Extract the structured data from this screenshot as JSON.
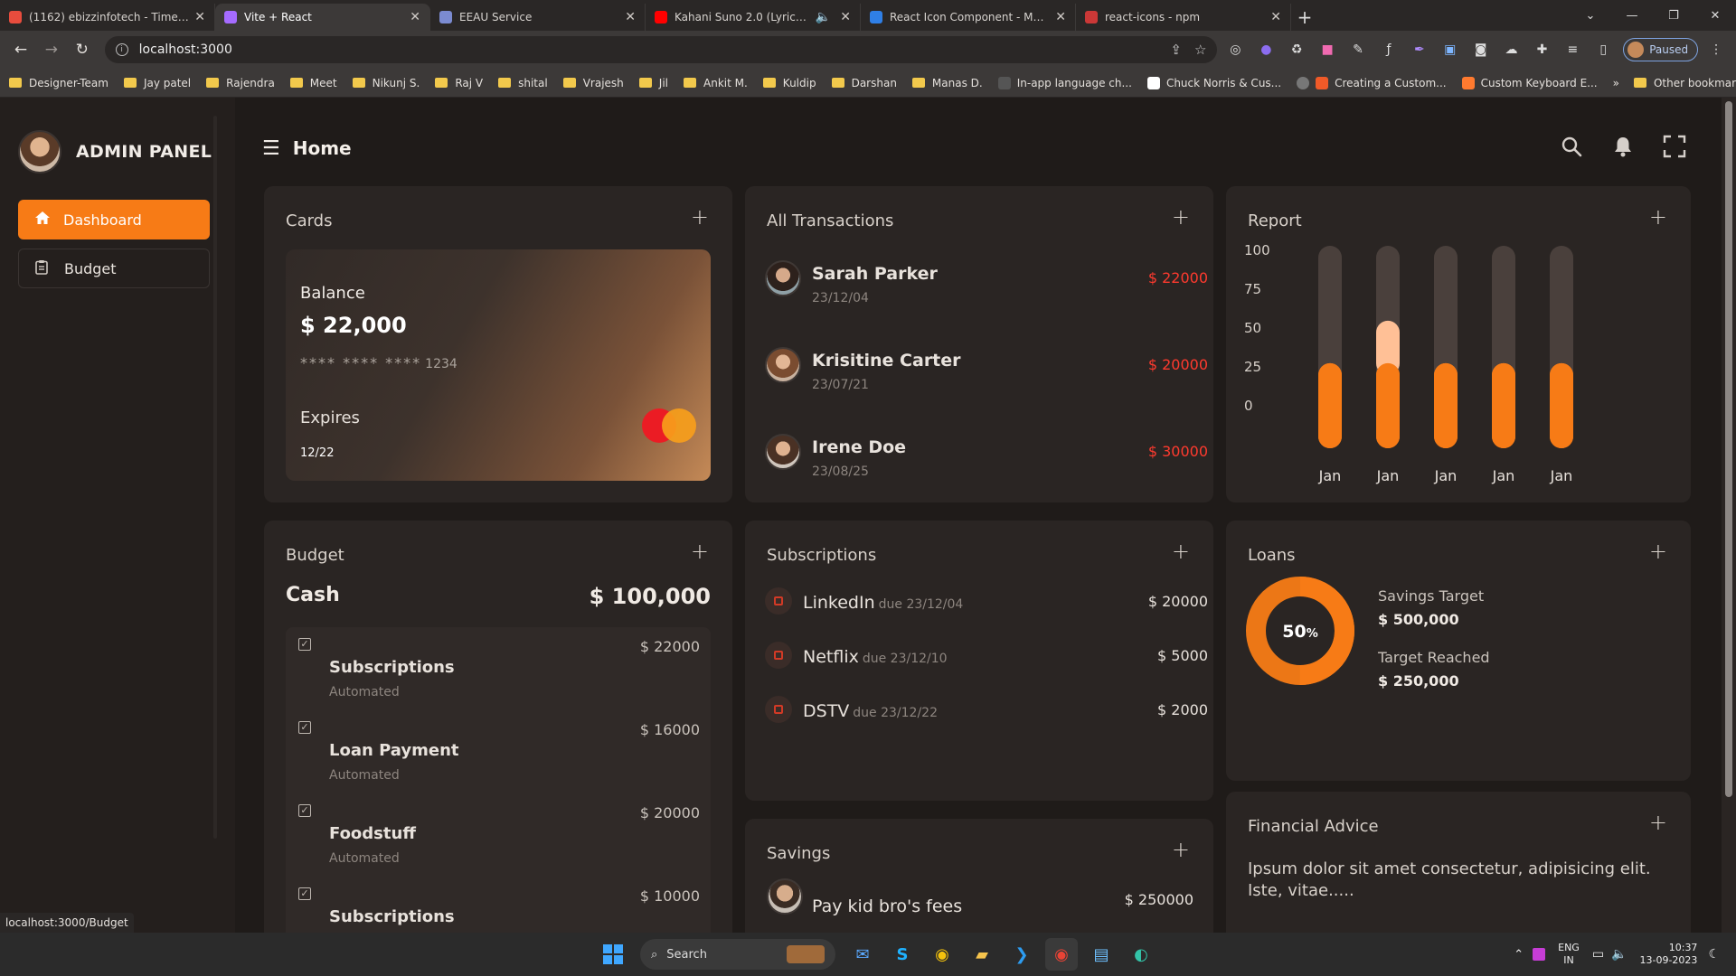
{
  "browser": {
    "tabs": [
      {
        "title": "(1162) ebizzinfotech - Timesheet",
        "favicon_color": "#e84c3d",
        "active": false
      },
      {
        "title": "Vite + React",
        "favicon_color": "#a56bff",
        "active": true
      },
      {
        "title": "EEAU Service",
        "favicon_color": "#7b8bd1",
        "active": false
      },
      {
        "title": "Kahani Suno 2.0 (Lyrics) | Ma",
        "favicon_color": "#ff0000",
        "active": false
      },
      {
        "title": "React Icon Component - Materia",
        "favicon_color": "#2f7fe6",
        "active": false
      },
      {
        "title": "react-icons - npm",
        "favicon_color": "#cb3837",
        "active": false
      }
    ],
    "url": "localhost:3000",
    "profile_status": "Paused",
    "bookmarks": [
      "Designer-Team",
      "Jay patel",
      "Rajendra",
      "Meet",
      "Nikunj S.",
      "Raj V",
      "shital",
      "Vrajesh",
      "Jil",
      "Ankit M.",
      "Kuldip",
      "Darshan",
      "Manas D.",
      "In-app language ch...",
      "Chuck Norris & Cus...",
      "Creating a Custom...",
      "Custom Keyboard E..."
    ],
    "other_bookmarks": "Other bookmarks",
    "status_url": "localhost:3000/Budget"
  },
  "sidebar": {
    "panel_title": "ADMIN PANEL",
    "items": [
      {
        "label": "Dashboard",
        "icon": "home-icon",
        "active": true
      },
      {
        "label": "Budget",
        "icon": "clipboard-icon",
        "active": false
      }
    ]
  },
  "header": {
    "title": "Home"
  },
  "cards_widget": {
    "title": "Cards",
    "balance_label": "Balance",
    "balance": "$ 22,000",
    "masked_number": "**** **** ****",
    "last_digits": "1234",
    "expires_label": "Expires",
    "expiry": "12/22"
  },
  "transactions": {
    "title": "All Transactions",
    "items": [
      {
        "name": "Sarah Parker",
        "date": "23/12/04",
        "amount": "$ 22000"
      },
      {
        "name": "Krisitine Carter",
        "date": "23/07/21",
        "amount": "$ 20000"
      },
      {
        "name": "Irene Doe",
        "date": "23/08/25",
        "amount": "$ 30000"
      }
    ]
  },
  "report": {
    "title": "Report",
    "chart_data": {
      "type": "bar",
      "categories": [
        "Jan",
        "Jan",
        "Jan",
        "Jan",
        "Jan"
      ],
      "y_ticks": [
        "100",
        "75",
        "50",
        "25",
        "0"
      ],
      "ylim": [
        0,
        100
      ],
      "series": [
        {
          "values": [
            42,
            42,
            42,
            42,
            42
          ],
          "color": "#f77b16"
        },
        {
          "values": [
            0,
            21,
            0,
            0,
            0
          ],
          "color": "#ffc096"
        }
      ],
      "track_color": "#4a403c"
    }
  },
  "budget": {
    "title": "Budget",
    "cash_label": "Cash",
    "total": "$ 100,000",
    "items": [
      {
        "name": "Subscriptions",
        "sub": "Automated",
        "amount": "$ 22000"
      },
      {
        "name": "Loan Payment",
        "sub": "Automated",
        "amount": "$ 16000"
      },
      {
        "name": "Foodstuff",
        "sub": "Automated",
        "amount": "$ 20000"
      },
      {
        "name": "Subscriptions",
        "sub": "",
        "amount": "$ 10000"
      }
    ]
  },
  "subscriptions": {
    "title": "Subscriptions",
    "items": [
      {
        "name": "LinkedIn",
        "due": "due 23/12/04",
        "amount": "$ 20000"
      },
      {
        "name": "Netflix",
        "due": "due 23/12/10",
        "amount": "$ 5000"
      },
      {
        "name": "DSTV",
        "due": "due 23/12/22",
        "amount": "$ 2000"
      }
    ]
  },
  "loans": {
    "title": "Loans",
    "progress_percent": 50,
    "percent_number": "50",
    "percent_sign": "%",
    "savings_target_label": "Savings Target",
    "savings_target": "$ 500,000",
    "target_reached_label": "Target Reached",
    "target_reached": "$ 250,000",
    "ring_color": "#f77b16"
  },
  "savings": {
    "title": "Savings",
    "item": {
      "name": "Pay kid bro's fees",
      "amount": "$ 250000"
    }
  },
  "advice": {
    "title": "Financial Advice",
    "text": "Ipsum dolor sit amet consectetur, adipisicing elit. Iste, vitae....."
  },
  "taskbar": {
    "search_label": "Search",
    "lang_top": "ENG",
    "lang_bottom": "IN",
    "time": "10:37",
    "date": "13-09-2023"
  },
  "colors": {
    "accent": "#f77b16",
    "negative": "#ff3a2e",
    "card_bg": "#2a2523",
    "page_bg": "#1f1b19"
  }
}
